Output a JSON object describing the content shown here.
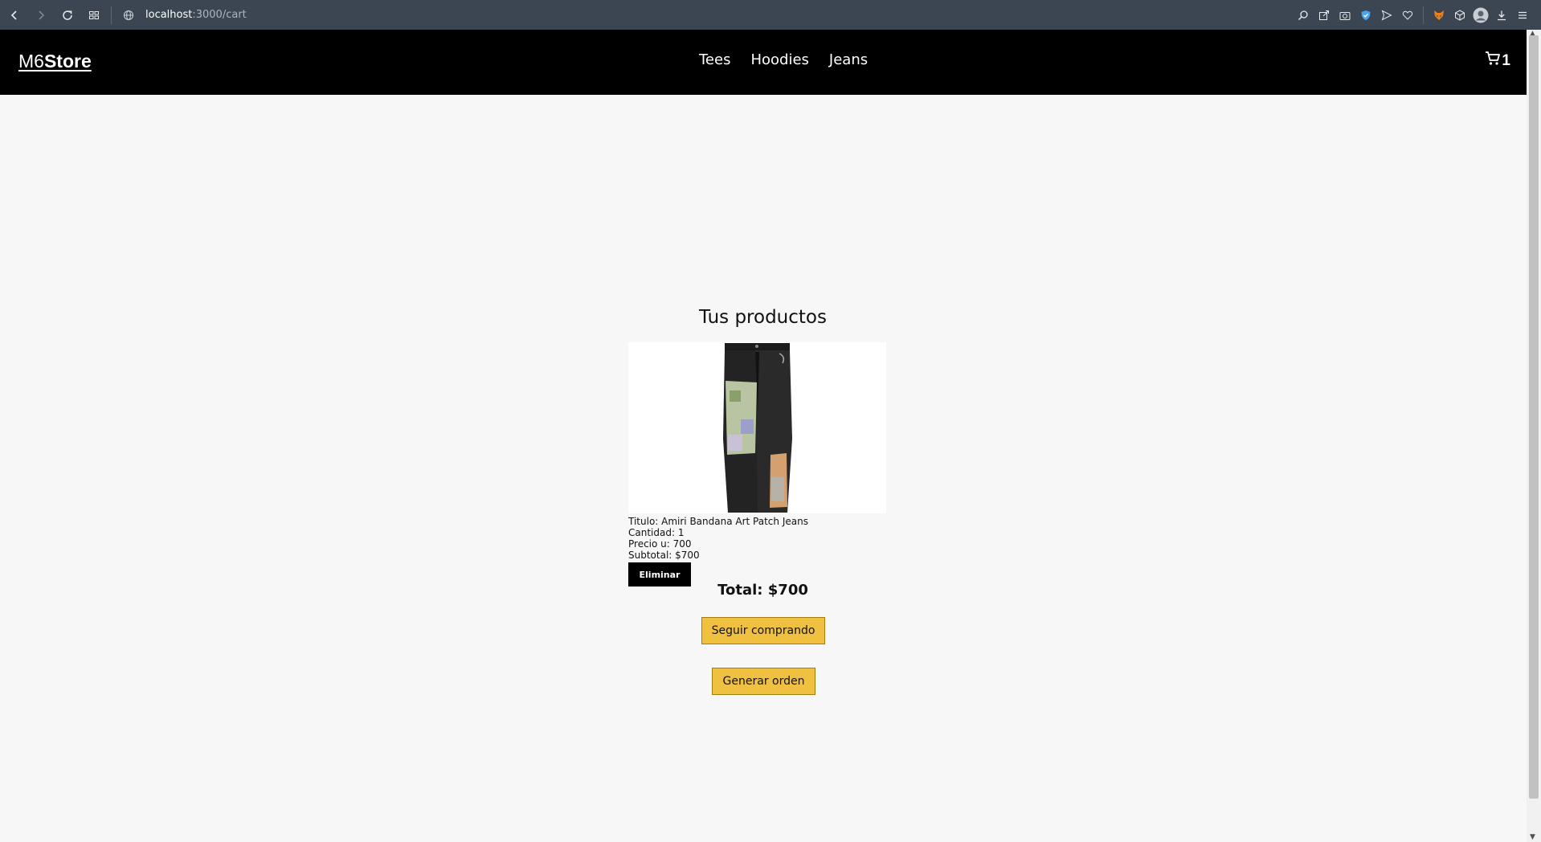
{
  "browser": {
    "url_host": "localhost",
    "url_path": ":3000/cart"
  },
  "header": {
    "brand_light": "M6",
    "brand_bold": "Store",
    "nav": [
      "Tees",
      "Hoodies",
      "Jeans"
    ],
    "cart_count": "1"
  },
  "cart": {
    "title": "Tus productos",
    "item": {
      "titulo": "Titulo: Amiri Bandana Art Patch Jeans",
      "cantidad": "Cantidad: 1",
      "precio": "Precio u: 700",
      "subtotal": "Subtotal: $700",
      "remove_label": "Eliminar"
    },
    "total": "Total: $700",
    "continue_label": "Seguir comprando",
    "order_label": "Generar orden"
  },
  "colors": {
    "header_bg": "#000000",
    "page_bg": "#f7f7f7",
    "cta_bg": "#f0c040",
    "browser_bg": "#3b4652"
  }
}
